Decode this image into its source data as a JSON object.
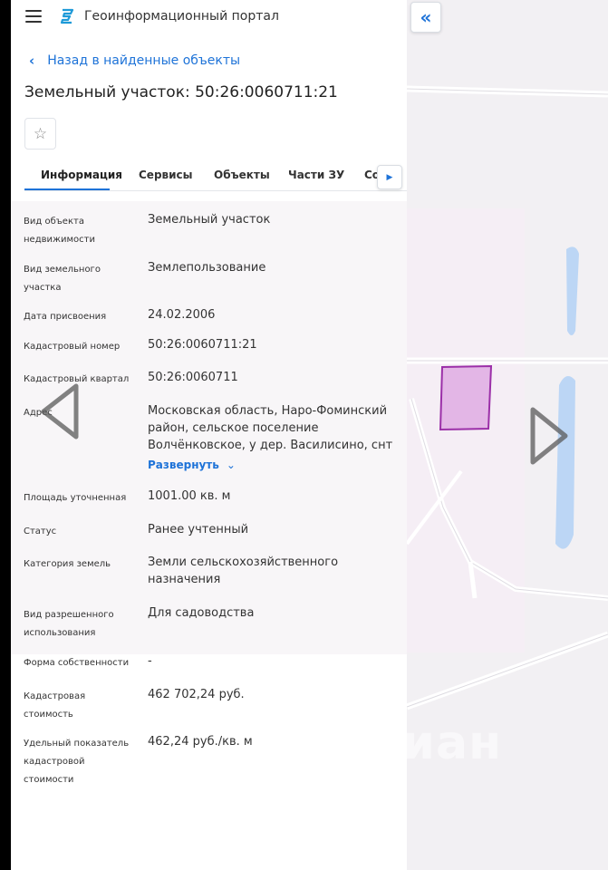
{
  "app": {
    "title": "Геоинформационный портал"
  },
  "back_link": "Назад в найденные объекты",
  "page_title": "Земельный участок: 50:26:0060711:21",
  "tabs": [
    {
      "label": "Информация"
    },
    {
      "label": "Сервисы"
    },
    {
      "label": "Объекты"
    },
    {
      "label": "Части ЗУ"
    },
    {
      "label": "Сост"
    }
  ],
  "info": [
    {
      "label": "Вид объекта недвижимости",
      "value": "Земельный участок"
    },
    {
      "label": "Вид земельного участка",
      "value": "Землепользование"
    },
    {
      "label": "Дата присвоения",
      "value": "24.02.2006"
    },
    {
      "label": "Кадастровый номер",
      "value": "50:26:0060711:21"
    },
    {
      "label": "Кадастровый квартал",
      "value": "50:26:0060711"
    },
    {
      "label": "Адрес",
      "value": "Московская область, Наро-Фоминский район, сельское поселение Волчёнковское, у дер. Василисино, снт"
    },
    {
      "label": "Площадь уточненная",
      "value": "1001.00 кв. м"
    },
    {
      "label": "Статус",
      "value": "Ранее учтенный"
    },
    {
      "label": "Категория земель",
      "value": "Земли сельскохозяйственного назначения"
    },
    {
      "label": "Вид разрешенного использования",
      "value": "Для садоводства"
    },
    {
      "label": "Форма собственности",
      "value": "-"
    },
    {
      "label": "Кадастровая стоимость",
      "value": "462 702,24 руб."
    },
    {
      "label": "Удельный показатель кадастровой стоимости",
      "value": "462,24 руб./кв. м"
    }
  ],
  "expand_label": "Развернуть",
  "watermark": "циан",
  "colors": {
    "accent": "#1e73d8",
    "parcel_fill": "#e3b6e6",
    "parcel_stroke": "#9b2fa8",
    "water": "#bcd6f5"
  },
  "icons": [
    "menu-icon",
    "portal-logo-icon",
    "chevron-left-icon",
    "star-icon",
    "chevron-right-icon",
    "double-chevron-left-icon",
    "chevron-down-icon"
  ]
}
